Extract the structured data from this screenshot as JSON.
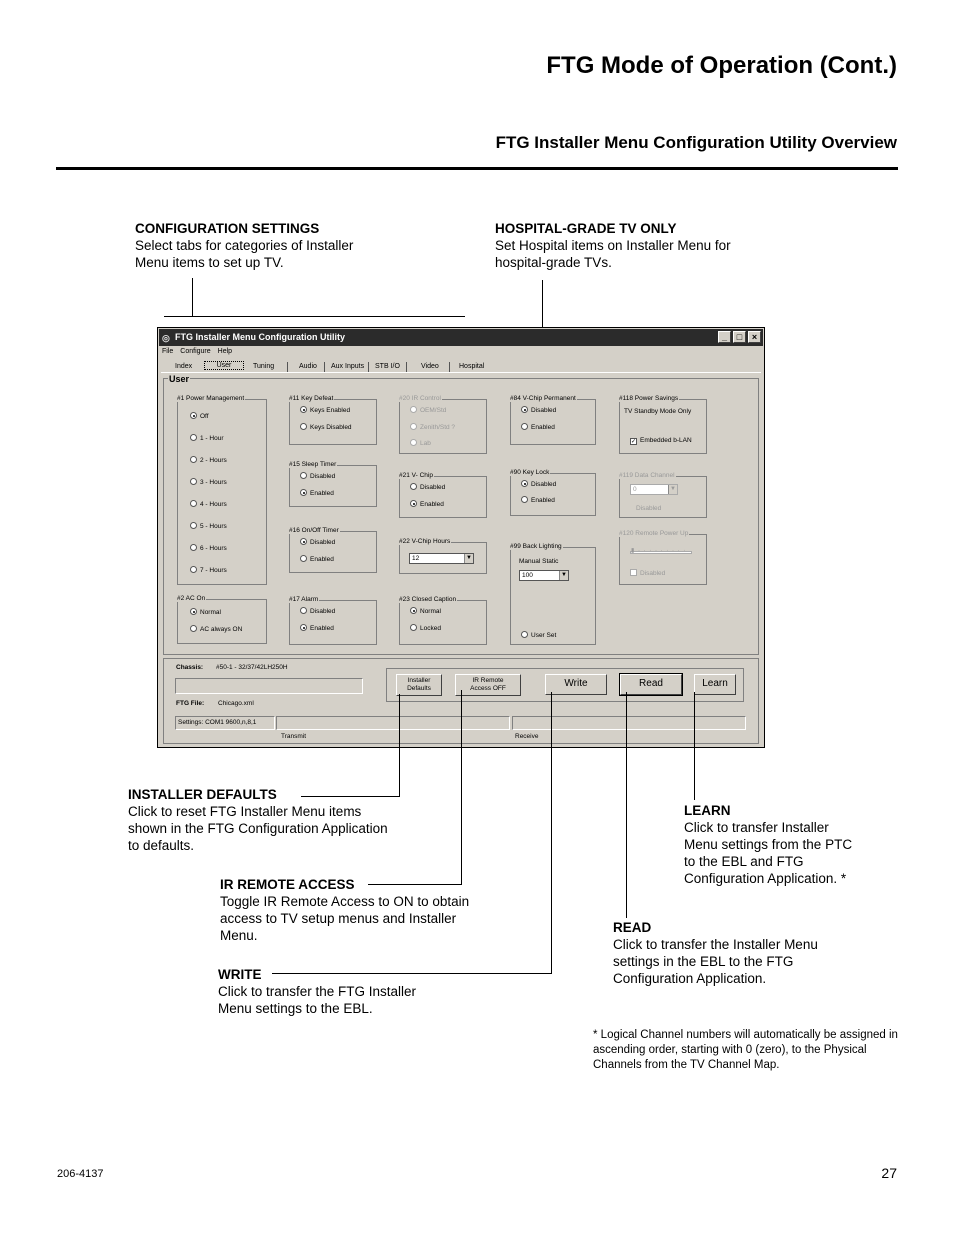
{
  "page": {
    "title": "FTG Mode of Operation (Cont.)",
    "section": "FTG Installer Menu Configuration Utility Overview",
    "doc_number": "206-4137",
    "page_number": "27"
  },
  "callouts": {
    "config": {
      "title": "CONFIGURATION SETTINGS",
      "body": "Select tabs for categories of Installer Menu items to set up TV."
    },
    "hospital": {
      "title": "HOSPITAL-GRADE TV ONLY",
      "body": "Set Hospital items on Installer Menu for hospital-grade TVs."
    },
    "installer_defaults": {
      "title": "INSTALLER DEFAULTS",
      "body": "Click to reset FTG Installer Menu items shown in the FTG Configuration Application to defaults."
    },
    "ir_remote": {
      "title": "IR REMOTE ACCESS",
      "body": "Toggle IR Remote Access to ON to obtain access to TV setup menus and Installer Menu."
    },
    "write": {
      "title": "WRITE",
      "body": "Click to transfer the FTG Installer Menu settings to the EBL."
    },
    "learn": {
      "title": "LEARN",
      "body": "Click to transfer Installer Menu settings from the PTC to the EBL and FTG Configuration Application. *"
    },
    "read": {
      "title": "READ",
      "body": "Click to transfer the Installer Menu settings in the EBL to the FTG Configuration Application."
    }
  },
  "footnote": "* Logical Channel numbers will automatically be assigned in ascending order, starting with 0 (zero), to the Physical Channels from the TV Channel Map.",
  "app": {
    "window_title": "FTG Installer Menu Configuration Utility",
    "menu": [
      "File",
      "Configure",
      "Help"
    ],
    "tabs": [
      "Index",
      "User",
      "Tuning",
      "Audio",
      "Aux Inputs",
      "STB I/O",
      "Video",
      "Hospital"
    ],
    "panel_label": "User",
    "power_mgmt": {
      "title": "#1 Power Management",
      "options": [
        "Off",
        "1 - Hour",
        "2 - Hours",
        "3 - Hours",
        "4 - Hours",
        "5 - Hours",
        "6 - Hours",
        "7 - Hours"
      ]
    },
    "ac_on": {
      "title": "#2 AC On",
      "options": [
        "Normal",
        "AC always ON"
      ]
    },
    "key_defeat": {
      "title": "#11 Key Defeat",
      "options": [
        "Keys Enabled",
        "Keys Disabled"
      ]
    },
    "sleep_timer": {
      "title": "#15 Sleep Timer",
      "options": [
        "Disabled",
        "Enabled"
      ]
    },
    "onoff_timer": {
      "title": "#16 On/Off Timer",
      "options": [
        "Disabled",
        "Enabled"
      ]
    },
    "alarm": {
      "title": "#17 Alarm",
      "options": [
        "Disabled",
        "Enabled"
      ]
    },
    "ir_control": {
      "title": "#20 IR Control",
      "options": [
        "OEM/Std",
        "Zenith/Std ?",
        "Lab"
      ]
    },
    "vchip": {
      "title": "#21 V- Chip",
      "options": [
        "Disabled",
        "Enabled"
      ]
    },
    "vchip_hours": {
      "title": "#22 V-Chip Hours",
      "value": "12"
    },
    "closed_caption": {
      "title": "#23 Closed Caption",
      "options": [
        "Normal",
        "Locked"
      ]
    },
    "vchip_perm": {
      "title": "#84 V-Chip Permanent",
      "options": [
        "Disabled",
        "Enabled"
      ]
    },
    "key_lock": {
      "title": "#90 Key Lock",
      "options": [
        "Disabled",
        "Enabled"
      ]
    },
    "back_lighting": {
      "title": "#99 Back Lighting",
      "sub": "Manual Static",
      "value": "100",
      "option": "User Set"
    },
    "power_savings": {
      "title": "#118 Power Savings",
      "sub": "TV Standby Mode Only",
      "check": "Embedded b-LAN"
    },
    "data_channel": {
      "title": "#119 Data Channel",
      "value": "0",
      "status": "Disabled"
    },
    "remote_power": {
      "title": "#120 Remote Power Up",
      "check": "Disabled"
    },
    "chassis": {
      "label": "Chassis:",
      "value": "#50-1 - 32/37/42LH250H"
    },
    "ftg_file": {
      "label": "FTG File:",
      "value": "Chicago.xml"
    },
    "settings": "Settings: COM1 9600,n,8,1",
    "transmit": "Transmit",
    "receive": "Receive",
    "buttons": {
      "installer_defaults": [
        "Installer",
        "Defaults"
      ],
      "ir_remote": [
        "IR Remote",
        "Access OFF"
      ],
      "write": "Write",
      "read": "Read",
      "learn": "Learn"
    }
  }
}
